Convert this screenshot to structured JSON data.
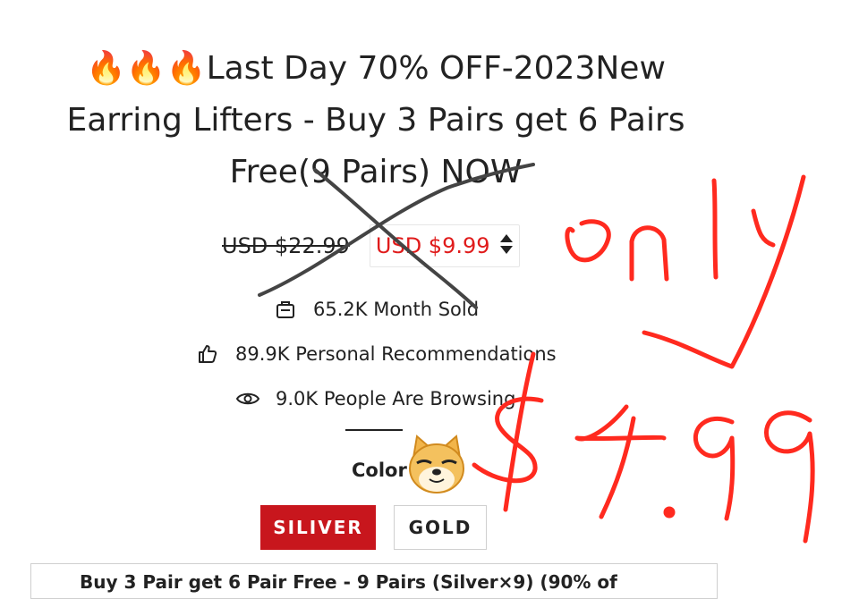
{
  "product": {
    "title_icon": "fire-emoji",
    "title": "🔥🔥🔥Last Day 70% OFF-2023New Earring Lifters - Buy 3 Pairs get 6 Pairs Free(9 Pairs) NOW",
    "old_price": "USD $22.99",
    "new_price": "USD $9.99",
    "price_toggle_icon": "sort-arrows-icon"
  },
  "stats": [
    {
      "icon": "shopping-bag-icon",
      "text": "65.2K Month Sold"
    },
    {
      "icon": "thumbs-up-icon",
      "text": "89.9K Personal Recommendations"
    },
    {
      "icon": "eye-icon",
      "text": "9.0K People Are Browsing"
    }
  ],
  "color": {
    "label": "Color",
    "options": [
      {
        "label": "SILIVER",
        "selected": true
      },
      {
        "label": "GOLD",
        "selected": false
      }
    ]
  },
  "bundle": {
    "text": "Buy 3 Pair get 6 Pair Free - 9 Pairs (Silver×9) (90% of"
  },
  "annotations": {
    "handwritten": "only $4.99",
    "handwriting_color": "#ff2a1f",
    "cross_color": "#444444",
    "sticker": "doge-face-emoji"
  },
  "colors": {
    "accent_red": "#c8161d",
    "sale_price": "#e01b1b"
  }
}
